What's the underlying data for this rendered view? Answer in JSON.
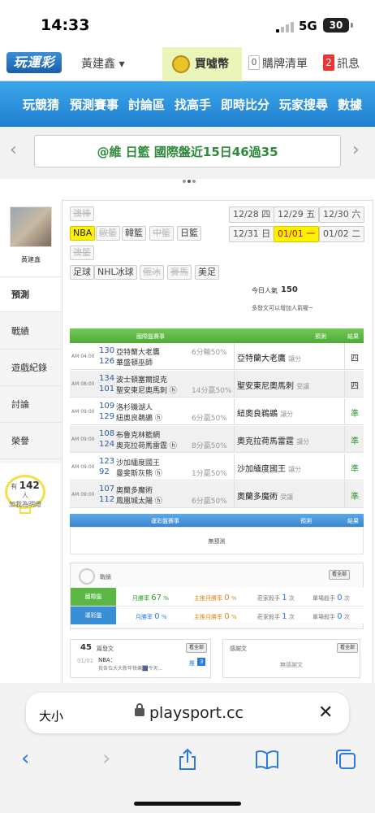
{
  "status": {
    "time": "14:33",
    "network": "5G",
    "battery": "30"
  },
  "topnav": {
    "logo": "玩運彩",
    "user": "黃建鑫 ▾",
    "buy": "買噓幣",
    "cart_count": "0",
    "cart": "購牌清單",
    "msg_count": "2",
    "msg": "訊息"
  },
  "menu": [
    "玩競猜",
    "預測賽事",
    "討論區",
    "找高手",
    "即時比分",
    "玩家搜尋",
    "數據"
  ],
  "banner": {
    "text": "@維 日籃 國際盤近15日46過35"
  },
  "sidebar": {
    "username": "黃建鑫",
    "items": [
      "預測",
      "戰績",
      "遊戲紀錄",
      "討論",
      "榮譽"
    ],
    "bulb_prefix": "有",
    "bulb_count": "142",
    "bulb_unit": "人",
    "bulb_note": "加我為明燈"
  },
  "sports": {
    "row1": [
      "澳棒"
    ],
    "row2": [
      "NBA",
      "歐籃",
      "韓籃",
      "中籃",
      "日籃"
    ],
    "row3": [
      "澳籃"
    ],
    "row4": [
      "足球",
      "NHL冰球",
      "俄冰",
      "賽馬",
      "美足"
    ]
  },
  "dates": [
    "12/28 四",
    "12/29 五",
    "12/30 六",
    "12/31 日",
    "01/01 一",
    "01/02 二"
  ],
  "popularity": {
    "label": "今日人氣",
    "value": "150",
    "note": "多發文可以增加人氣喔~"
  },
  "table": {
    "header": {
      "match": "國際盤賽事",
      "pick": "預測",
      "result": "結果"
    },
    "rows": [
      {
        "time": "AM 04:00",
        "n1": "130",
        "t1": "亞特蘭大老鷹",
        "n2": "126",
        "t2": "華盛頓巫師",
        "odds": "6分輸50%",
        "pick": "亞特蘭大老鷹",
        "ptype": "讓分",
        "result": "四"
      },
      {
        "time": "AM 08:00",
        "n1": "134",
        "t1": "波士頓塞爾提克",
        "n2": "101",
        "t2": "聖安東尼奧馬刺 ⓗ",
        "odds": "14分贏50%",
        "pick": "聖安東尼奧馬刺",
        "ptype": "受讓",
        "result": "四"
      },
      {
        "time": "AM 09:00",
        "n1": "109",
        "t1": "洛杉磯湖人",
        "n2": "129",
        "t2": "紐奧良鵜鶘 ⓗ",
        "odds": "6分贏50%",
        "pick": "紐奧良鵜鶘",
        "ptype": "讓分",
        "result": "準"
      },
      {
        "time": "AM 09:00",
        "n1": "108",
        "t1": "布魯克林籃網",
        "n2": "124",
        "t2": "奧克拉荷馬雷霆 ⓗ",
        "odds": "8分贏50%",
        "pick": "奧克拉荷馬雷霆",
        "ptype": "讓分",
        "result": "準"
      },
      {
        "time": "AM 09:00",
        "n1": "123",
        "t1": "沙加緬度國王",
        "n2": "92",
        "t2": "曼斐斯灰熊 ⓗ",
        "odds": "1分贏50%",
        "pick": "沙加緬度國王",
        "ptype": "讓分",
        "result": "準"
      },
      {
        "time": "AM 09:00",
        "n1": "107",
        "t1": "奧蘭多魔術",
        "n2": "112",
        "t2": "鳳凰城太陽 ⓗ",
        "odds": "6分贏50%",
        "pick": "奧蘭多魔術",
        "ptype": "受讓",
        "result": "準"
      }
    ]
  },
  "table2": {
    "match": "運彩盤賽事",
    "pick": "預測",
    "result": "結果",
    "empty": "無預測"
  },
  "stats": {
    "title": "戰績",
    "see_all": "看全部",
    "rows": [
      {
        "label": "國際盤",
        "winrate_l": "月勝率",
        "winrate": "67",
        "pct": "%",
        "main_l": "主推月勝率",
        "main": "0",
        "main_pct": "%",
        "zhuang_l": "莊家殺手",
        "zhuang": "1",
        "zhuang_u": "次",
        "single_l": "單場殺手",
        "single": "0",
        "single_u": "次"
      },
      {
        "label": "運彩盤",
        "winrate_l": "月勝率",
        "winrate": "0",
        "pct": "%",
        "main_l": "主推月勝率",
        "main": "0",
        "main_pct": "%",
        "zhuang_l": "莊家殺手",
        "zhuang": "1",
        "zhuang_u": "次",
        "single_l": "單場殺手",
        "single": "0",
        "single_u": "次"
      }
    ]
  },
  "posts": {
    "count": "45",
    "label": "篇發文",
    "see_all": "看全部",
    "item_date": "01/01",
    "item_title": "NBA：",
    "item_snippet": "我各位大大新年快樂🎆今天...",
    "item_push": "推",
    "item_push_count": "3"
  },
  "replies": {
    "label": "感謝文",
    "see_all": "看全部",
    "empty": "無感謝文"
  },
  "browser": {
    "aa": "大小",
    "url": "playsport.cc"
  }
}
